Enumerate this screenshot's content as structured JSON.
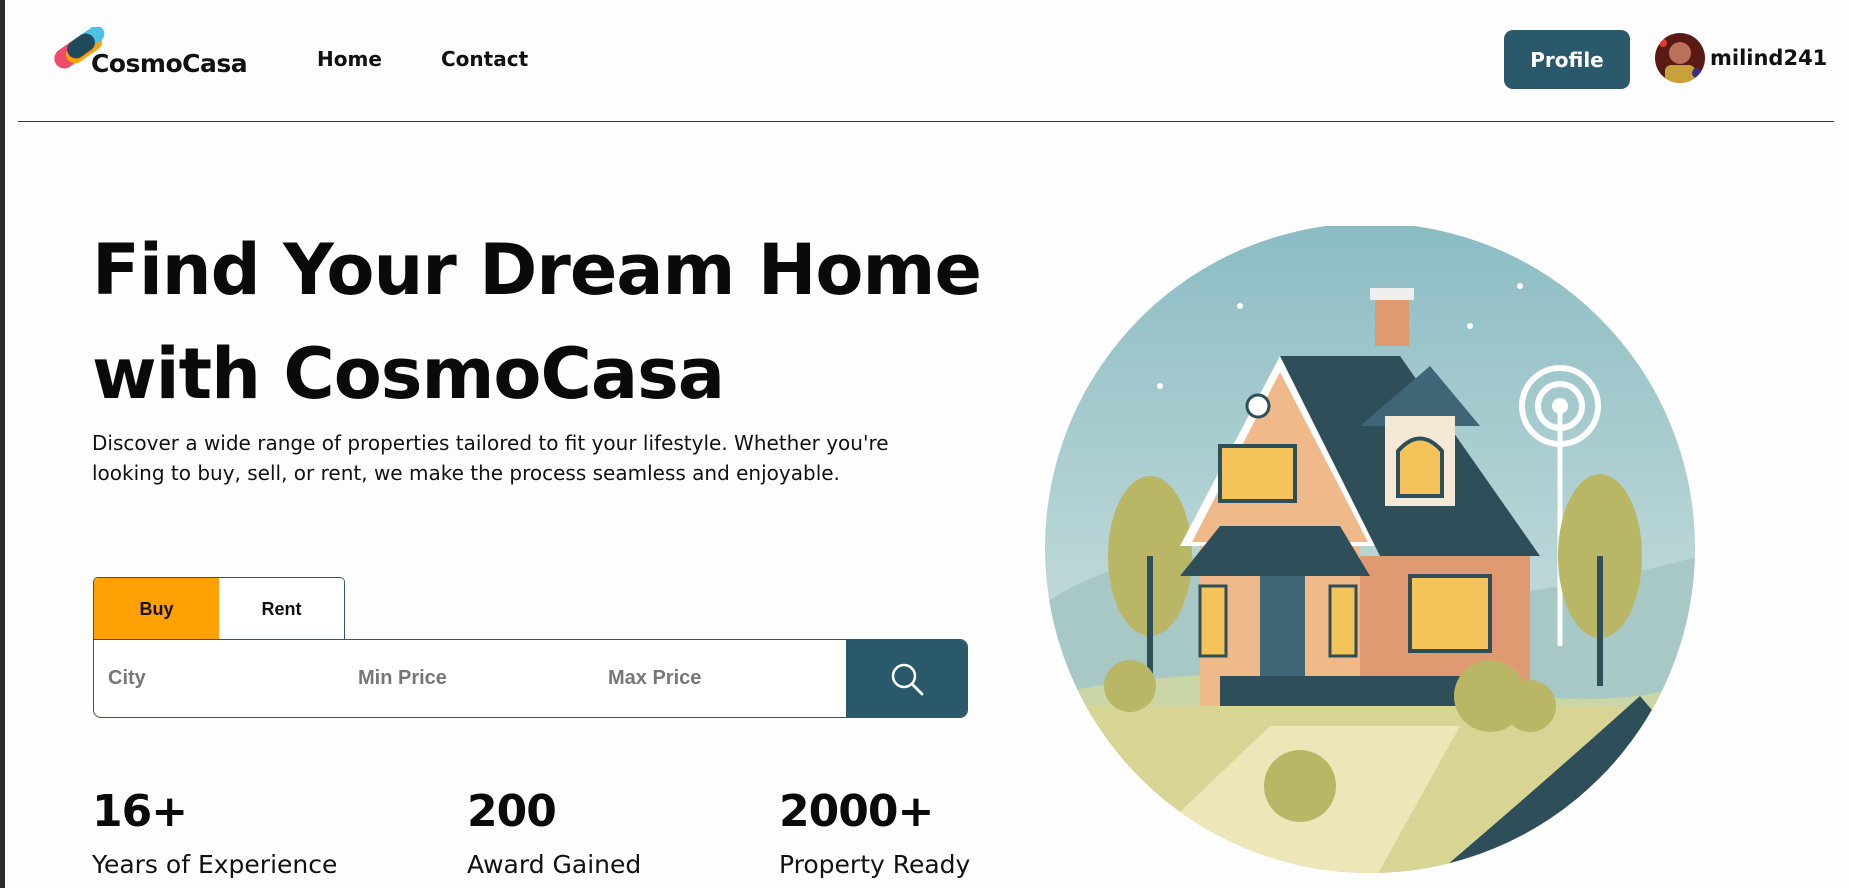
{
  "brand": {
    "name": "CosmoCasa"
  },
  "nav": {
    "links": [
      "Home",
      "Contact"
    ]
  },
  "header": {
    "profile_label": "Profile",
    "username": "milind241"
  },
  "hero": {
    "title_line1": "Find Your Dream Home",
    "title_line2": "with CosmoCasa",
    "description": "Discover a wide range of properties tailored to fit your lifestyle. Whether you're looking to buy, sell, or rent, we make the process seamless and enjoyable."
  },
  "search": {
    "tabs": [
      {
        "label": "Buy",
        "active": true
      },
      {
        "label": "Rent",
        "active": false
      }
    ],
    "fields": {
      "city_placeholder": "City",
      "min_price_placeholder": "Min Price",
      "max_price_placeholder": "Max Price"
    },
    "button_icon": "search-icon"
  },
  "stats": [
    {
      "value": "16+",
      "label": "Years of Experience"
    },
    {
      "value": "200",
      "label": "Award Gained"
    },
    {
      "value": "2000+",
      "label": "Property Ready"
    }
  ],
  "colors": {
    "primary": "#2a596b",
    "accent": "#ffa005",
    "background": "#fdfdfd",
    "text": "#111111"
  }
}
